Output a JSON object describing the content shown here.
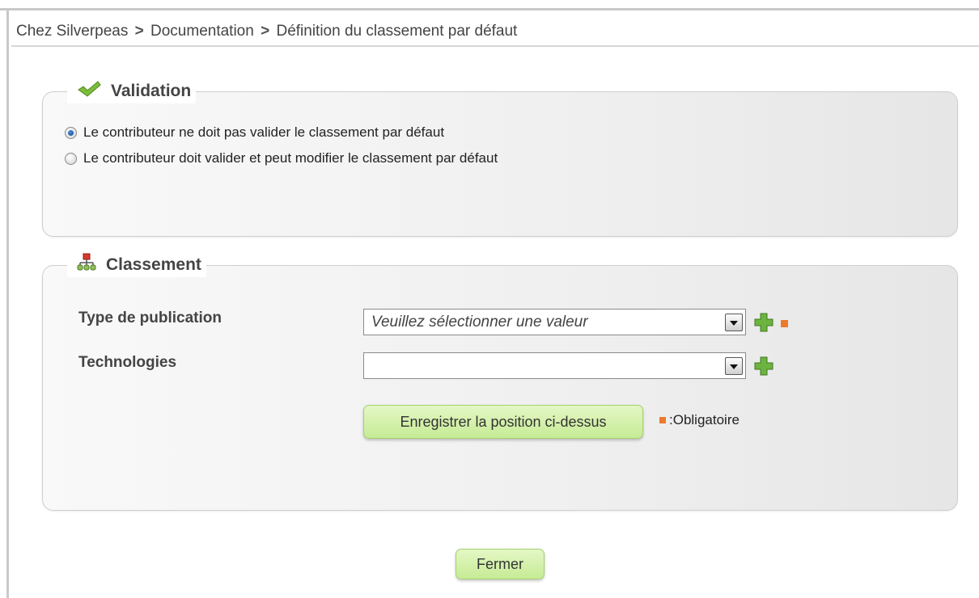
{
  "breadcrumb": {
    "items": [
      "Chez Silverpeas",
      "Documentation",
      "Définition du classement par défaut"
    ],
    "separator": ">"
  },
  "validation": {
    "legend": "Validation",
    "icon": "checkmark-icon",
    "options": [
      {
        "label": "Le contributeur ne doit pas valider le classement par défaut",
        "checked": true
      },
      {
        "label": "Le contributeur doit valider et peut modifier le classement par défaut",
        "checked": false
      }
    ]
  },
  "classement": {
    "legend": "Classement",
    "icon": "hierarchy-icon",
    "fields": [
      {
        "label": "Type de publication",
        "value": "Veuillez sélectionner une valeur",
        "required": true
      },
      {
        "label": "Technologies",
        "value": "",
        "required": false
      }
    ],
    "save_button": "Enregistrer la position ci-dessus",
    "required_legend": ":Obligatoire"
  },
  "close_button": "Fermer",
  "colors": {
    "required": "#ec7a2b",
    "button_green": "#c6eb94",
    "plus_green": "#6cb33f"
  }
}
